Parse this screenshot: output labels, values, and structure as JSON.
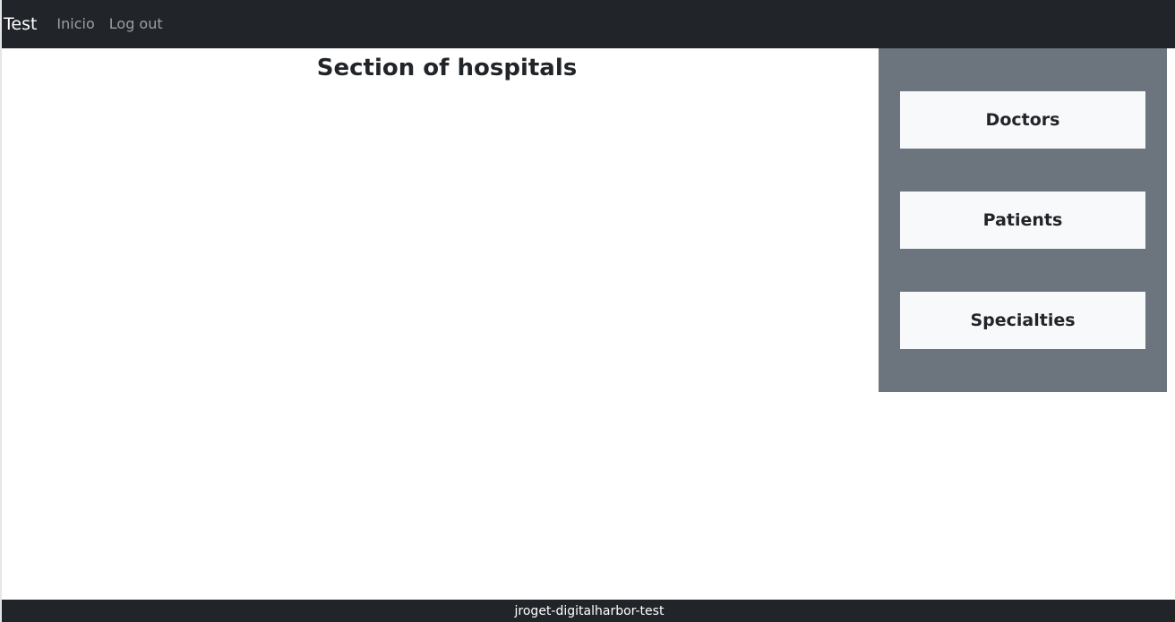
{
  "navbar": {
    "brand": "Test",
    "links": [
      {
        "label": "Inicio"
      },
      {
        "label": "Log out"
      }
    ]
  },
  "main": {
    "title": "Section of hospitals"
  },
  "sidebar": {
    "items": [
      {
        "label": "Doctors"
      },
      {
        "label": "Patients"
      },
      {
        "label": "Specialties"
      }
    ]
  },
  "footer": {
    "text": "jroget-digitalharbor-test"
  },
  "colors": {
    "navbar_bg": "#212529",
    "sidebar_bg": "#6c757d",
    "button_bg": "#f8f9fa",
    "text_dark": "#212529"
  }
}
